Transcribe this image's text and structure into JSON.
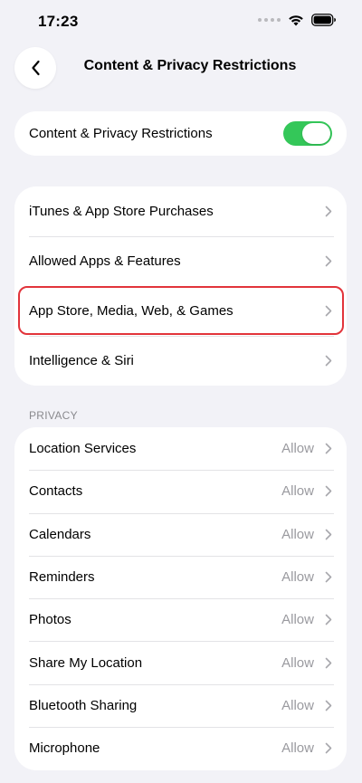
{
  "status_bar": {
    "time": "17:23"
  },
  "nav": {
    "title": "Content & Privacy Restrictions"
  },
  "master": {
    "label": "Content & Privacy Restrictions",
    "enabled": true
  },
  "menu": {
    "items": [
      {
        "label": "iTunes & App Store Purchases"
      },
      {
        "label": "Allowed Apps & Features"
      },
      {
        "label": "App Store, Media, Web, & Games",
        "highlighted": true
      },
      {
        "label": "Intelligence & Siri"
      }
    ]
  },
  "privacy": {
    "header": "PRIVACY",
    "items": [
      {
        "label": "Location Services",
        "value": "Allow"
      },
      {
        "label": "Contacts",
        "value": "Allow"
      },
      {
        "label": "Calendars",
        "value": "Allow"
      },
      {
        "label": "Reminders",
        "value": "Allow"
      },
      {
        "label": "Photos",
        "value": "Allow"
      },
      {
        "label": "Share My Location",
        "value": "Allow"
      },
      {
        "label": "Bluetooth Sharing",
        "value": "Allow"
      },
      {
        "label": "Microphone",
        "value": "Allow"
      }
    ]
  },
  "colors": {
    "toggle_on": "#34c759",
    "highlight": "#e2343b",
    "background": "#f2f2f7"
  },
  "icons": {
    "back": "chevron-left-icon",
    "disclosure": "chevron-right-icon",
    "wifi": "wifi-icon",
    "battery": "battery-icon"
  }
}
